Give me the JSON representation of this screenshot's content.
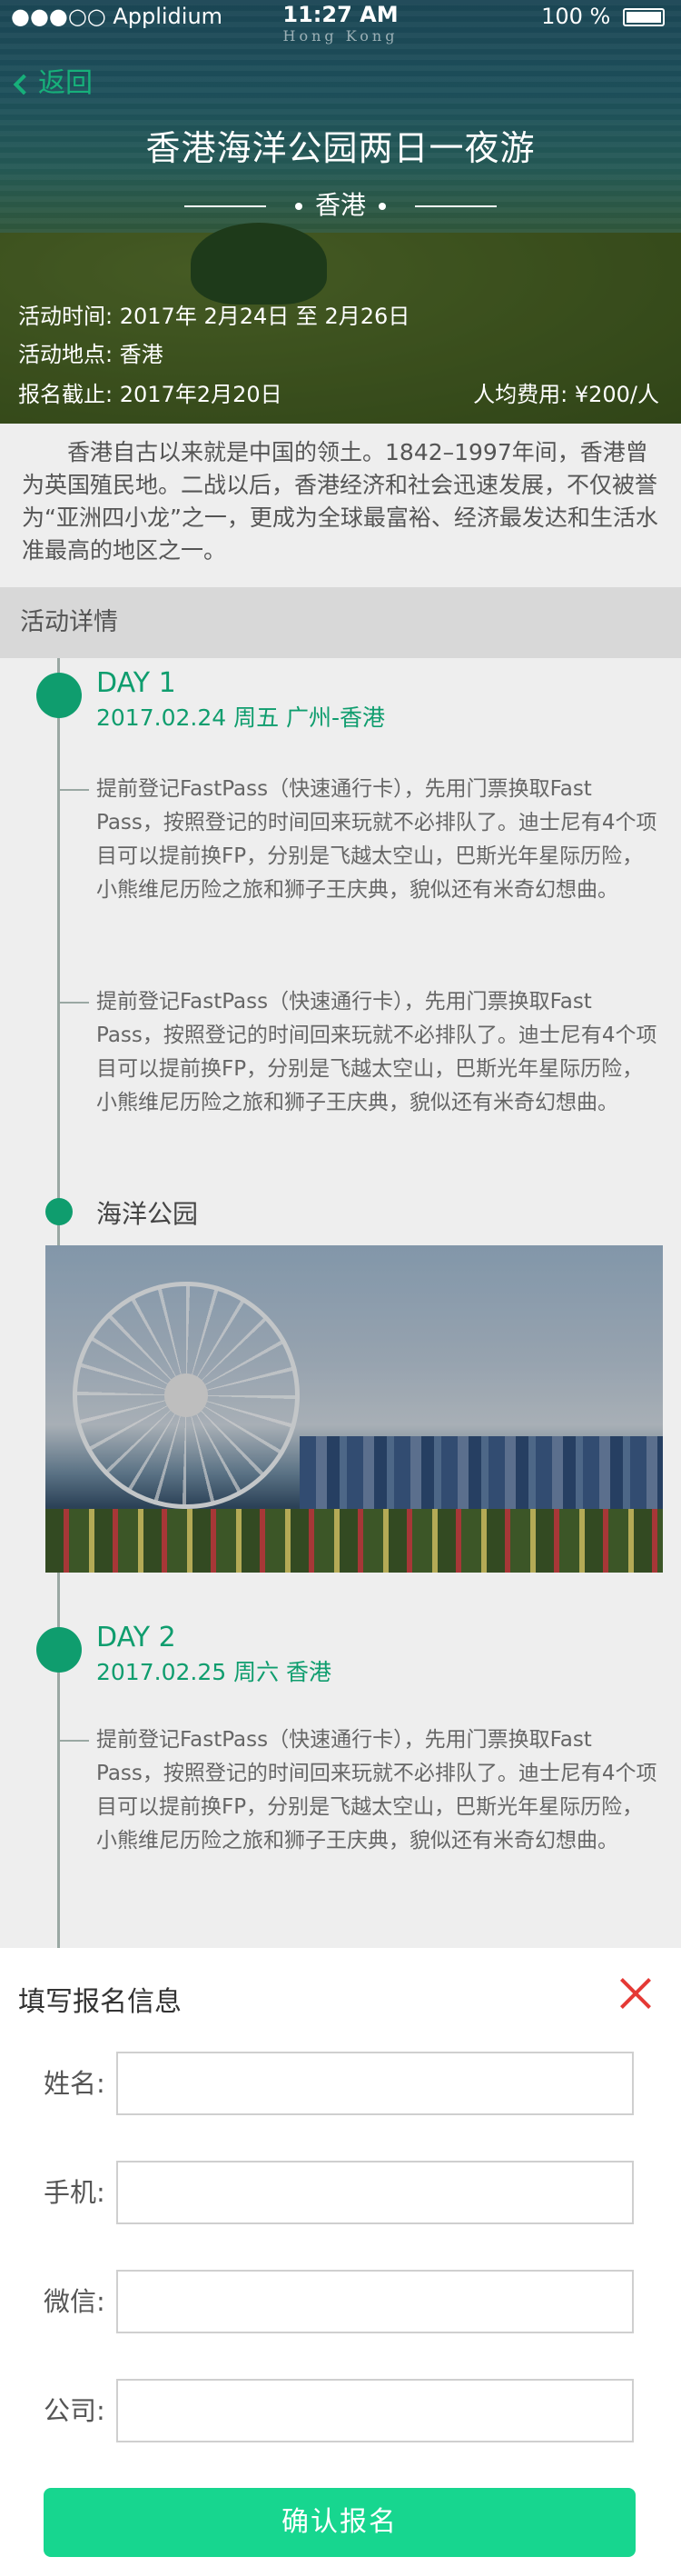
{
  "status_bar": {
    "carrier": "●●●○○ Applidium",
    "time": "11:27 AM",
    "battery": "100 %"
  },
  "header": {
    "subtitle_en": "Hong Kong",
    "back_label": "返回",
    "title": "香港海洋公园两日一夜游",
    "location": "香港",
    "date_label": "活动时间:",
    "date_value": "2017年 2月24日 至 2月26日",
    "place_label": "活动地点:",
    "place_value": "香港",
    "deadline_label": "报名截止:",
    "deadline_value": "2017年2月20日",
    "fee": "人均费用: ¥200/人"
  },
  "intro": "香港自古以来就是中国的领土。1842–1997年间，香港曾为英国殖民地。二战以后，香港经济和社会迅速发展，不仅被誉为“亚洲四小龙”之一，更成为全球最富裕、经济最发达和生活水准最高的地区之一。",
  "section_title": "活动详情",
  "days": [
    {
      "title": "DAY 1",
      "subtitle": "2017.02.24   周五   广州-香港",
      "items": [
        "提前登记FastPass（快速通行卡），先用门票换取Fast Pass，按照登记的时间回来玩就不必排队了。迪士尼有4个项目可以提前换FP，分别是飞越太空山，巴斯光年星际历险，小熊维尼历险之旅和狮子王庆典，貌似还有米奇幻想曲。",
        "提前登记FastPass（快速通行卡），先用门票换取Fast Pass，按照登记的时间回来玩就不必排队了。迪士尼有4个项目可以提前换FP，分别是飞越太空山，巴斯光年星际历险，小熊维尼历险之旅和狮子王庆典，貌似还有米奇幻想曲。"
      ],
      "stop": "海洋公园"
    },
    {
      "title": "DAY 2",
      "subtitle": "2017.02.25   周六   香港",
      "items": [
        "提前登记FastPass（快速通行卡），先用门票换取Fast Pass，按照登记的时间回来玩就不必排队了。迪士尼有4个项目可以提前换FP，分别是飞越太空山，巴斯光年星际历险，小熊维尼历险之旅和狮子王庆典，貌似还有米奇幻想曲。"
      ]
    }
  ],
  "form": {
    "title": "填写报名信息",
    "fields": [
      {
        "label": "姓名:",
        "value": ""
      },
      {
        "label": "手机:",
        "value": ""
      },
      {
        "label": "微信:",
        "value": ""
      },
      {
        "label": "公司:",
        "value": ""
      }
    ],
    "submit_label": "确认报名"
  },
  "colors": {
    "accent": "#0f9d6e",
    "button": "#17d68f",
    "close": "#e53935"
  }
}
